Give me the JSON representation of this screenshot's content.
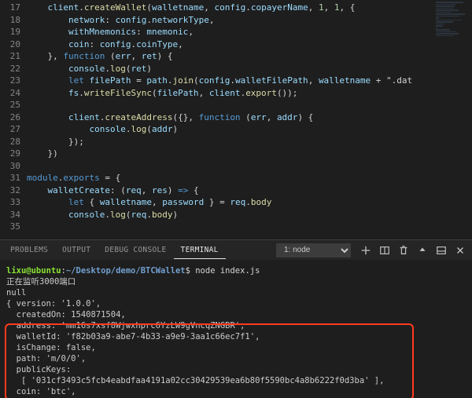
{
  "editor": {
    "startLine": 17,
    "lines": [
      "    client.createWallet(walletname, config.copayerName, 1, 1, {",
      "        network: config.networkType,",
      "        withMnemonics: mnemonic,",
      "        coin: config.coinType,",
      "    }, function (err, ret) {",
      "        console.log(ret)",
      "        let filePath = path.join(config.walletFilePath, walletname + \".dat",
      "        fs.writeFileSync(filePath, client.export());",
      "",
      "        client.createAddress({}, function (err, addr) {",
      "            console.log(addr)",
      "        });",
      "    })",
      "",
      "module.exports = {",
      "    walletCreate: (req, res) => {",
      "        let { walletname, password } = req.body",
      "        console.log(req.body)",
      ""
    ]
  },
  "panel": {
    "tabs": [
      "PROBLEMS",
      "OUTPUT",
      "DEBUG CONSOLE",
      "TERMINAL"
    ],
    "activeTab": "TERMINAL",
    "dropdown": "1: node"
  },
  "terminal": {
    "prompt": {
      "user": "lixu",
      "host": "ubuntu",
      "path": "~/Desktop/demo/BTCWallet",
      "command": "node index.js"
    },
    "lines": [
      "正在监听3000端口",
      "null",
      "{ version: '1.0.0',",
      "  createdOn: 1540871504,",
      "  address: 'mm16s7xsf8Wjwxhprc6YzLW9gVncqZNGBR',",
      "  walletId: 'f82b03a9-abe7-4b33-a9e9-3aa1c66ec7f1',",
      "  isChange: false,",
      "  path: 'm/0/0',",
      "  publicKeys:",
      "   [ '031cf3493c5fcb4eabdfaa4191a02cc30429539ea6b80f5590bc4a8b6222f0d3ba' ],",
      "  coin: 'btc',"
    ]
  }
}
